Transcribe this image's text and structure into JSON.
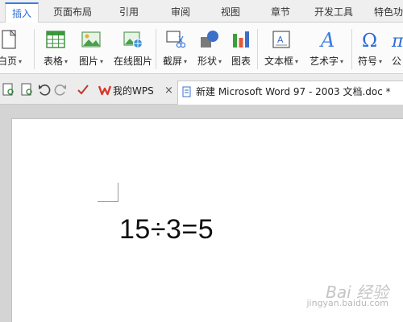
{
  "tabs": [
    "插入",
    "页面布局",
    "引用",
    "审阅",
    "视图",
    "章节",
    "开发工具",
    "特色功"
  ],
  "ribbon": {
    "items": [
      {
        "label": "白页",
        "icon": "blank-page-icon",
        "caret": true
      },
      {
        "label": "表格",
        "icon": "table-icon",
        "caret": true
      },
      {
        "label": "图片",
        "icon": "picture-icon",
        "caret": true
      },
      {
        "label": "在线图片",
        "icon": "online-picture-icon",
        "caret": false
      },
      {
        "label": "截屏",
        "icon": "screenshot-icon",
        "caret": true
      },
      {
        "label": "形状",
        "icon": "shapes-icon",
        "caret": true
      },
      {
        "label": "图表",
        "icon": "chart-icon",
        "caret": false
      },
      {
        "label": "文本框",
        "icon": "textbox-icon",
        "caret": true
      },
      {
        "label": "艺术字",
        "icon": "wordart-icon",
        "caret": true
      },
      {
        "label": "符号",
        "icon": "symbol-icon",
        "caret": true
      },
      {
        "label": "公",
        "icon": "formula-icon",
        "caret": false
      }
    ]
  },
  "doc_tabs": {
    "wps_tab": "我的WPS",
    "doc_tab": "新建 Microsoft Word 97 - 2003 文档.doc *"
  },
  "document": {
    "content": "15÷3=5"
  },
  "watermark": {
    "brand": "Bai 经验",
    "url": "jingyan.baidu.com"
  },
  "colors": {
    "accent": "#3b7be0",
    "wps_red": "#d9372b"
  }
}
